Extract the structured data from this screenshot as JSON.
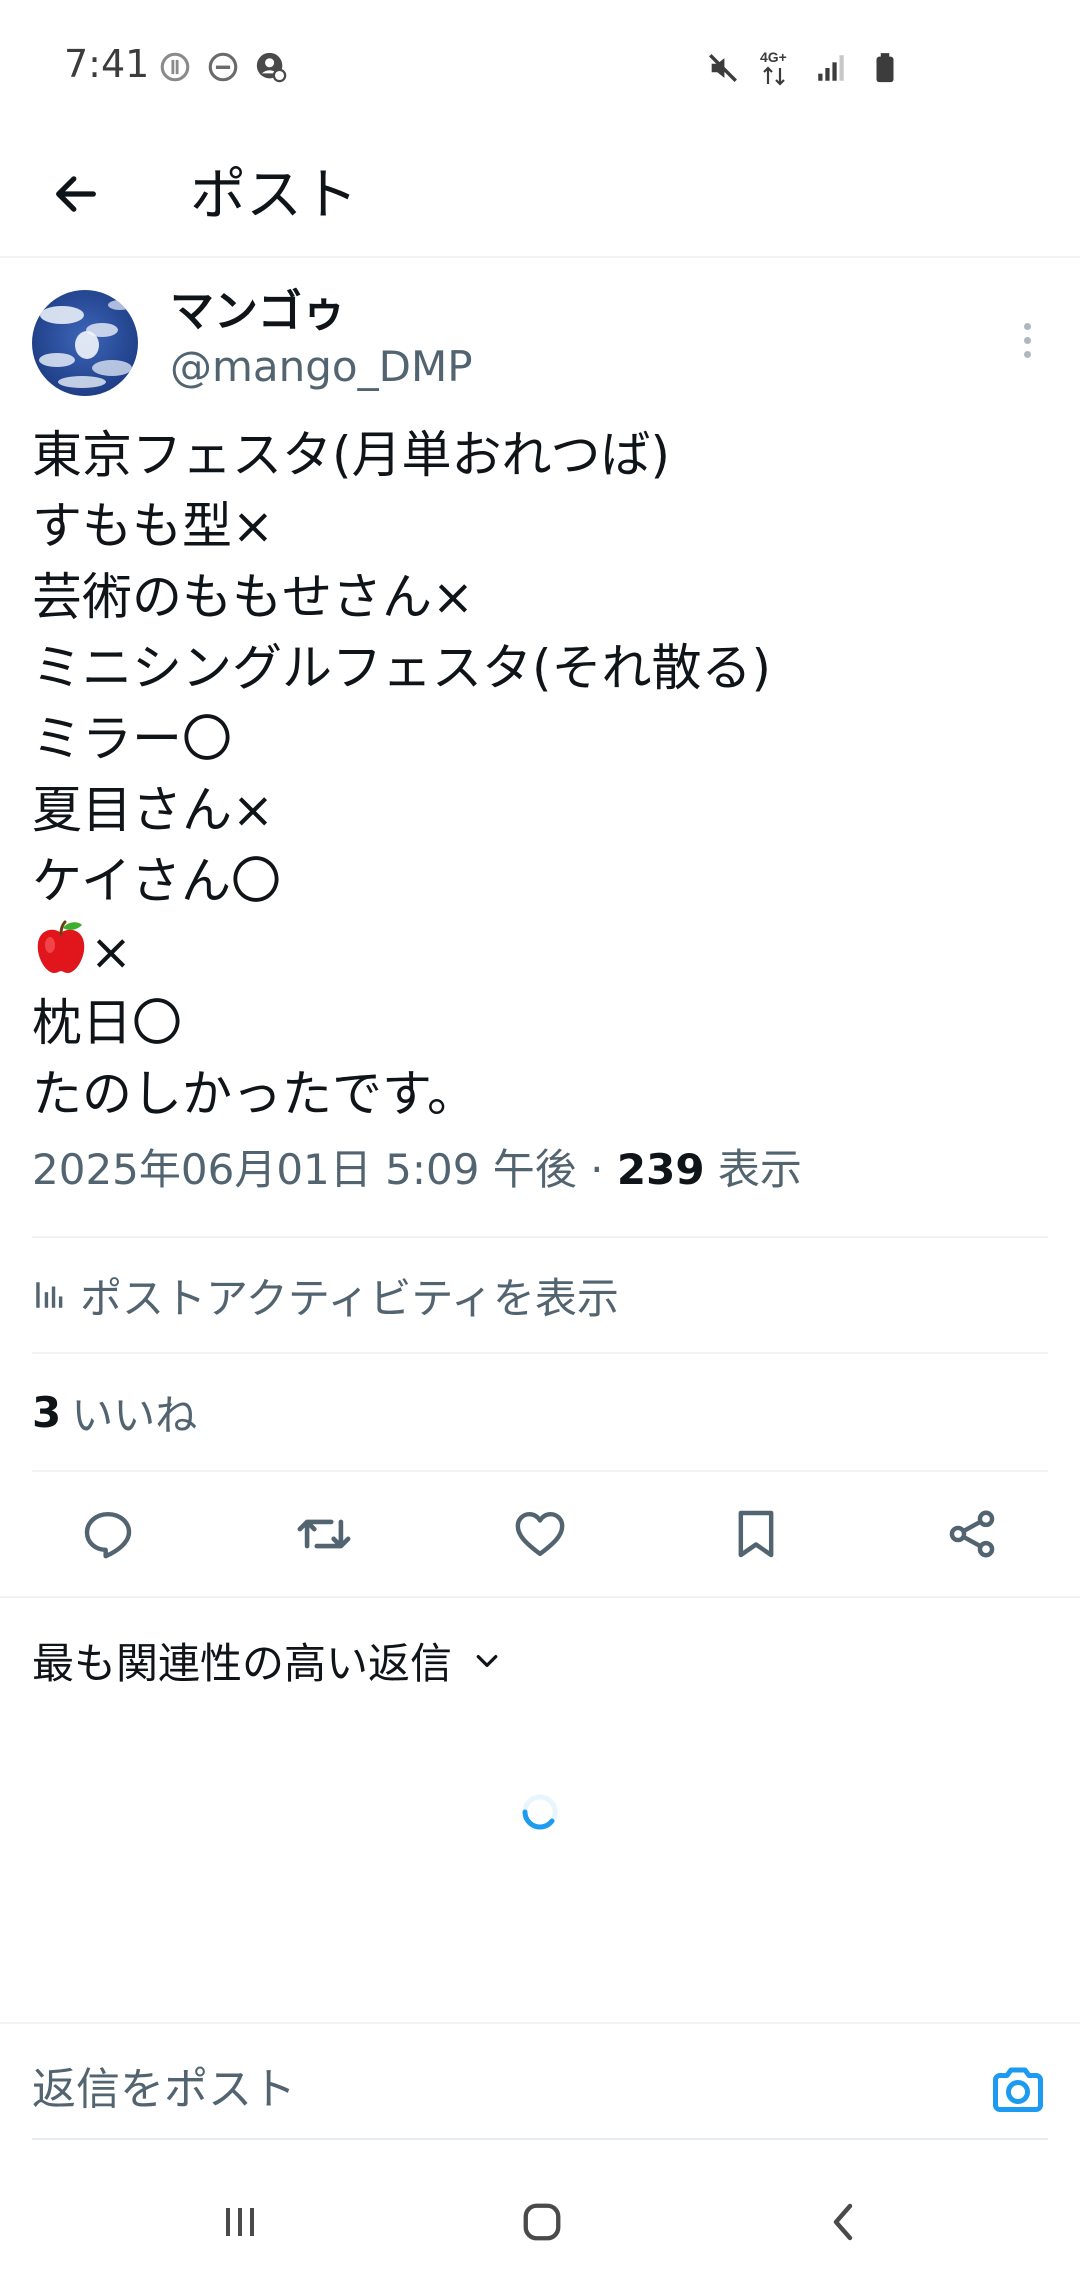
{
  "status_bar": {
    "time": "7:41",
    "left_icons": [
      "circle-alert-icon",
      "do-not-disturb-icon",
      "app-notification-icon"
    ],
    "network_label": "4G+",
    "right_icons": [
      "mute-icon",
      "data-arrows-icon",
      "signal-icon",
      "battery-icon"
    ]
  },
  "header": {
    "title": "ポスト",
    "back_icon": "arrow-left-icon"
  },
  "post": {
    "display_name": "マンゴゥ",
    "handle": "@mango_DMP",
    "lines": [
      "東京フェスタ(月単おれつば)",
      "すもも型×",
      "芸術のももせさん×",
      "ミニシングルフェスタ(それ散る)",
      "ミラー〇",
      "夏目さん×",
      "ケイさん〇",
      "×",
      "枕日〇",
      "たのしかったです。"
    ],
    "emoji_icon": "red-apple-icon",
    "timestamp": "2025年06月01日 5:09 午後",
    "separator": "·",
    "views_count": "239",
    "views_label": "表示"
  },
  "activity": {
    "label": "ポストアクティビティを表示",
    "icon": "bar-chart-icon"
  },
  "likes": {
    "count": "3",
    "label": "いいね"
  },
  "actions": [
    "reply-icon",
    "repost-icon",
    "like-icon",
    "bookmark-icon",
    "share-icon"
  ],
  "replies": {
    "sort_label": "最も関連性の高い返信",
    "sort_icon": "chevron-down-icon"
  },
  "reply_box": {
    "placeholder": "返信をポスト",
    "icon": "camera-icon"
  },
  "nav_bar": [
    "recent-apps-icon",
    "home-icon",
    "back-icon"
  ],
  "colors": {
    "primary_text": "#0f1419",
    "secondary_text": "#536471",
    "accent": "#1d9bf0",
    "divider": "#eff3f4"
  }
}
